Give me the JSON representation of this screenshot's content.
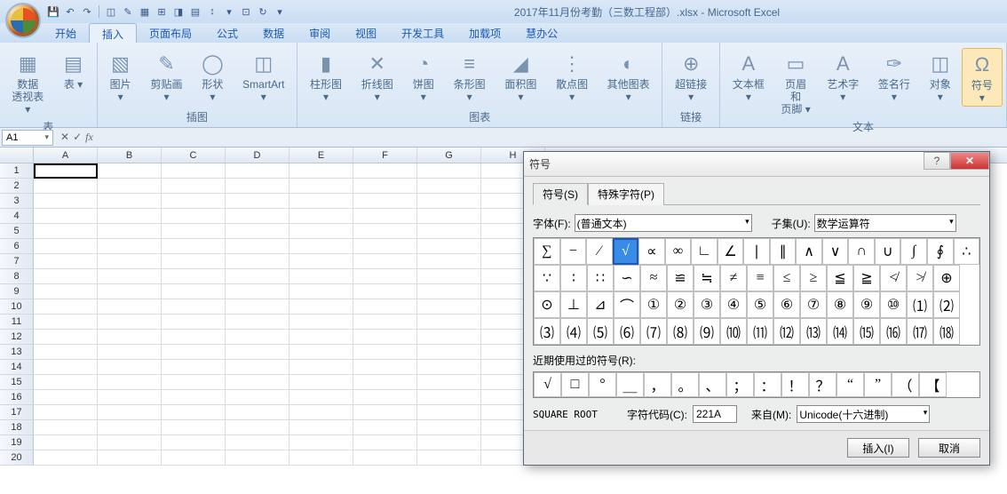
{
  "titlebar": {
    "title": "2017年11月份考勤（三数工程部）.xlsx - Microsoft Excel"
  },
  "tabs": [
    "开始",
    "插入",
    "页面布局",
    "公式",
    "数据",
    "审阅",
    "视图",
    "开发工具",
    "加载项",
    "慧办公"
  ],
  "activeTab": 1,
  "ribbon": {
    "groups": [
      {
        "label": "表",
        "items": [
          {
            "lbl": "数据\n透视表",
            "ico": "▦"
          },
          {
            "lbl": "表",
            "ico": "▤"
          }
        ]
      },
      {
        "label": "插图",
        "items": [
          {
            "lbl": "图片",
            "ico": "▧"
          },
          {
            "lbl": "剪贴画",
            "ico": "✎"
          },
          {
            "lbl": "形状",
            "ico": "◯"
          },
          {
            "lbl": "SmartArt",
            "ico": "◫"
          }
        ]
      },
      {
        "label": "图表",
        "items": [
          {
            "lbl": "柱形图",
            "ico": "▮"
          },
          {
            "lbl": "折线图",
            "ico": "✕"
          },
          {
            "lbl": "饼图",
            "ico": "◔"
          },
          {
            "lbl": "条形图",
            "ico": "≡"
          },
          {
            "lbl": "面积图",
            "ico": "◢"
          },
          {
            "lbl": "散点图",
            "ico": "⋮"
          },
          {
            "lbl": "其他图表",
            "ico": "◐"
          }
        ]
      },
      {
        "label": "链接",
        "items": [
          {
            "lbl": "超链接",
            "ico": "⊕"
          }
        ]
      },
      {
        "label": "文本",
        "items": [
          {
            "lbl": "文本框",
            "ico": "A"
          },
          {
            "lbl": "页眉和\n页脚",
            "ico": "▭"
          },
          {
            "lbl": "艺术字",
            "ico": "A"
          },
          {
            "lbl": "签名行",
            "ico": "✑"
          },
          {
            "lbl": "对象",
            "ico": "◫"
          },
          {
            "lbl": "符号",
            "ico": "Ω",
            "active": true
          }
        ]
      }
    ]
  },
  "formula": {
    "name": "A1",
    "fx": "fx"
  },
  "cols": [
    "A",
    "B",
    "C",
    "D",
    "E",
    "F",
    "G",
    "H"
  ],
  "rows": 20,
  "dialog": {
    "title": "符号",
    "tabs": [
      "符号(S)",
      "特殊字符(P)"
    ],
    "font_lbl": "字体(F):",
    "font": "(普通文本)",
    "subset_lbl": "子集(U):",
    "subset": "数学运算符",
    "grid": [
      [
        "∑",
        "−",
        "∕",
        "√",
        "∝",
        "∞",
        "∟",
        "∠",
        "∣",
        "∥",
        "∧",
        "∨",
        "∩",
        "∪",
        "∫",
        "∮",
        "∴"
      ],
      [
        "∵",
        "∶",
        "∷",
        "∽",
        "≈",
        "≌",
        "≒",
        "≠",
        "≡",
        "≤",
        "≥",
        "≦",
        "≧",
        "≮",
        "≯",
        "⊕"
      ],
      [
        "⊙",
        "⊥",
        "⊿",
        "⌒",
        "①",
        "②",
        "③",
        "④",
        "⑤",
        "⑥",
        "⑦",
        "⑧",
        "⑨",
        "⑩",
        "⑴",
        "⑵"
      ],
      [
        "⑶",
        "⑷",
        "⑸",
        "⑹",
        "⑺",
        "⑻",
        "⑼",
        "⑽",
        "⑾",
        "⑿",
        "⒀",
        "⒁",
        "⒂",
        "⒃",
        "⒄",
        "⒅"
      ]
    ],
    "selected": "√",
    "recent_lbl": "近期使用过的符号(R):",
    "recent": [
      "√",
      "□",
      "°",
      "＿",
      "，",
      "。",
      "、",
      "；",
      "：",
      "！",
      "？",
      "“",
      "”",
      "（",
      "【"
    ],
    "name": "SQUARE ROOT",
    "code_lbl": "字符代码(C):",
    "code": "221A",
    "from_lbl": "来自(M):",
    "from": "Unicode(十六进制)",
    "insert": "插入(I)",
    "cancel": "取消"
  }
}
